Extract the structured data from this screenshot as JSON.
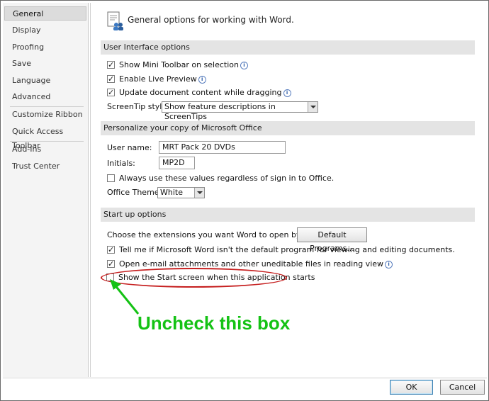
{
  "sidebar": {
    "items": [
      {
        "label": "General",
        "selected": true
      },
      {
        "label": "Display"
      },
      {
        "label": "Proofing"
      },
      {
        "label": "Save"
      },
      {
        "label": "Language"
      },
      {
        "label": "Advanced"
      },
      {
        "label": "Customize Ribbon"
      },
      {
        "label": "Quick Access Toolbar"
      },
      {
        "label": "Add-Ins"
      },
      {
        "label": "Trust Center"
      }
    ]
  },
  "header": {
    "icon": "general-options-icon",
    "text": "General options for working with Word."
  },
  "ui_options": {
    "title": "User Interface options",
    "mini_toolbar": {
      "label": "Show Mini Toolbar on selection",
      "checked": true
    },
    "live_preview": {
      "label": "Enable Live Preview",
      "checked": true
    },
    "update_content": {
      "label": "Update document content while dragging",
      "checked": true
    },
    "screentip_label": "ScreenTip style:",
    "screentip_value": "Show feature descriptions in ScreenTips"
  },
  "personalize": {
    "title": "Personalize your copy of Microsoft Office",
    "username_label": "User name:",
    "username_value": "MRT Pack 20 DVDs",
    "initials_label": "Initials:",
    "initials_value": "MP2D",
    "always_use": {
      "label": "Always use these values regardless of sign in to Office.",
      "checked": false
    },
    "theme_label": "Office Theme:",
    "theme_value": "White"
  },
  "startup": {
    "title": "Start up options",
    "extensions_label": "Choose the extensions you want Word to open by default:",
    "default_programs_button": "Default Programs...",
    "tell_me": {
      "label": "Tell me if Microsoft Word isn't the default program for viewing and editing documents.",
      "checked": true
    },
    "open_email": {
      "label": "Open e-mail attachments and other uneditable files in reading view",
      "checked": true
    },
    "show_start": {
      "label": "Show the Start screen when this application starts",
      "checked": false
    }
  },
  "annotation": {
    "text": "Uncheck this box",
    "highlight_color": "#c62020",
    "text_color": "#14c214"
  },
  "footer": {
    "ok_label": "OK",
    "cancel_label": "Cancel"
  }
}
